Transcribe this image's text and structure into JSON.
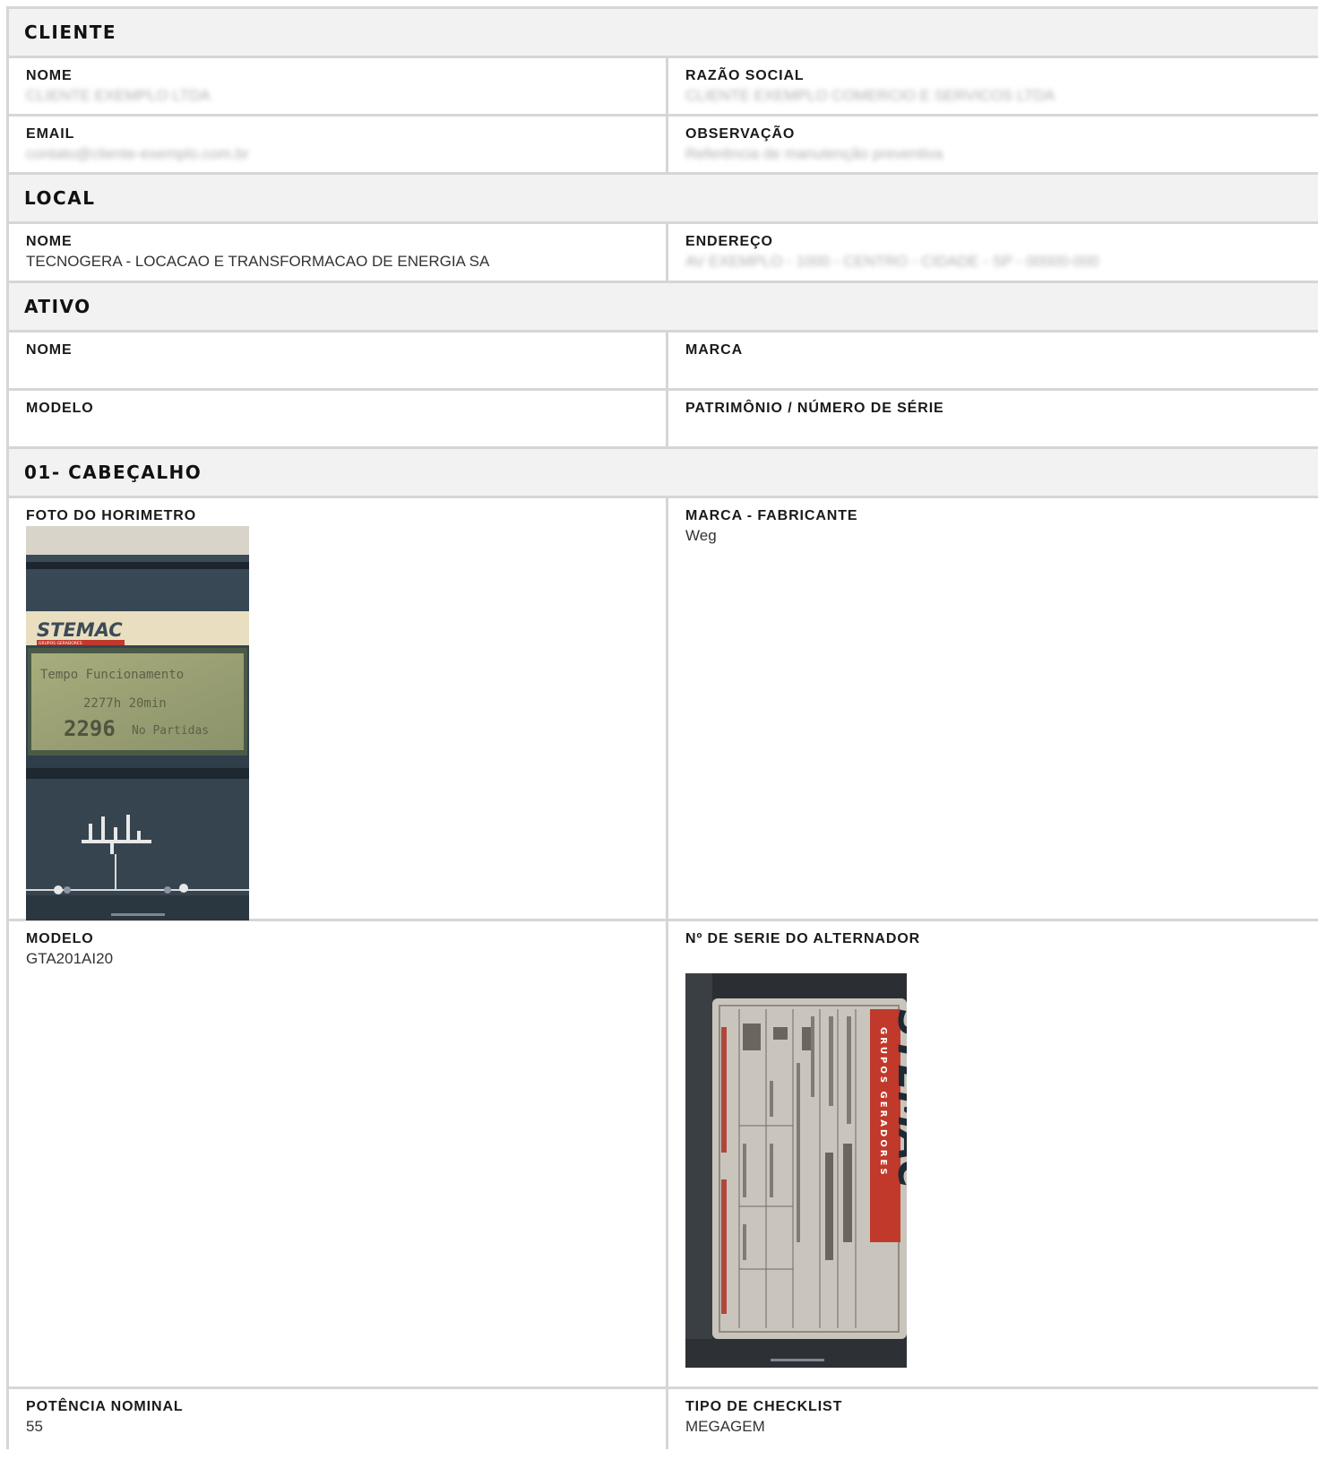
{
  "sections": {
    "cliente": {
      "title": "CLIENTE",
      "nome_label": "NOME",
      "nome_value": "CLIENTE EXEMPLO LTDA",
      "razao_label": "RAZÃO SOCIAL",
      "razao_value": "CLIENTE EXEMPLO COMERCIO E SERVICOS LTDA",
      "email_label": "EMAIL",
      "email_value": "contato@cliente-exemplo.com.br",
      "obs_label": "OBSERVAÇÃO",
      "obs_value": "Referência de manutenção preventiva"
    },
    "local": {
      "title": "LOCAL",
      "nome_label": "NOME",
      "nome_value": "TECNOGERA - LOCACAO E TRANSFORMACAO DE ENERGIA SA",
      "endereco_label": "ENDEREÇO",
      "endereco_value": "AV EXEMPLO - 1000 - CENTRO - CIDADE - SP - 00000-000"
    },
    "ativo": {
      "title": "ATIVO",
      "nome_label": "NOME",
      "marca_label": "MARCA",
      "modelo_label": "MODELO",
      "patrimonio_label": "PATRIMÔNIO / NÚMERO DE SÉRIE"
    },
    "cabecalho": {
      "title": "01- CABEÇALHO",
      "foto_label": "FOTO DO HORIMETRO",
      "marca_fab_label": "MARCA - FABRICANTE",
      "marca_fab_value": "Weg",
      "modelo_label": "MODELO",
      "modelo_value": "GTA201AI20",
      "serie_label": "Nº DE SERIE DO ALTERNADOR",
      "potencia_label": "POTÊNCIA NOMINAL",
      "potencia_value": "55",
      "checklist_label": "TIPO DE CHECKLIST",
      "checklist_value": "MEGAGEM"
    }
  },
  "horimetro_photo": {
    "brand": "STEMAC",
    "brand_sub": "GRUPOS GERADORES",
    "line1": "Tempo Funcionamento",
    "line2": "2277h 20min",
    "line3_big": "2296",
    "line3_small": "No Partidas"
  },
  "plate_photo": {
    "brand": "STEMAC",
    "brand_sub": "GRUPOS GERADORES"
  }
}
